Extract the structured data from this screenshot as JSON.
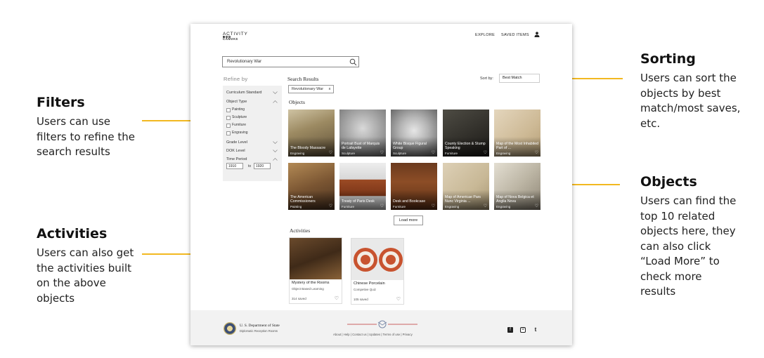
{
  "annotations": {
    "filters": {
      "title": "Filters",
      "lines": [
        "Users can use",
        "filters to refine the",
        "search results"
      ]
    },
    "activities": {
      "title": "Activities",
      "lines": [
        "Users can also get",
        "the activities built",
        "on the above",
        "objects"
      ]
    },
    "sorting": {
      "title": "Sorting",
      "lines": [
        "Users can sort the",
        "objects by best",
        "match/most saves,",
        "etc."
      ]
    },
    "objects": {
      "title": "Objects",
      "lines": [
        "Users can find the",
        "top 10 related",
        "objects here, they",
        "can also click",
        "“Load More” to",
        "check more",
        "results"
      ]
    }
  },
  "colors": {
    "accent": "#f2b820"
  },
  "header": {
    "brand_line1": "ACTIVITY",
    "brand_line2": "CANVAS",
    "nav_explore": "EXPLORE",
    "nav_saved": "SAVED ITEMS",
    "user_icon": "user-icon"
  },
  "search": {
    "value": "Revolutionary War",
    "icon": "search-icon"
  },
  "sidebar": {
    "refine_label": "Refine by",
    "curriculum": "Curriculum Standard",
    "object_type": "Object Type",
    "types": [
      "Painting",
      "Sculpture",
      "Furniture",
      "Engraving"
    ],
    "grade": "Grade Level",
    "dok": "DOK Level",
    "time_period": "Time Period",
    "year_from": "1910",
    "year_to": "1920",
    "to_label": "to"
  },
  "results": {
    "title": "Search Results",
    "tag": "Revolutionary War",
    "tag_close": "x",
    "sort_label": "Sort by:",
    "sort_value": "Best Match",
    "objects_heading": "Objects",
    "objects": [
      {
        "title": "The Bloody Massacre",
        "type": "Engraving"
      },
      {
        "title": "Portrait Bust of Marquis de Lafayette",
        "type": "Sculpture"
      },
      {
        "title": "White Bisque Figural Group",
        "type": "Sculpture"
      },
      {
        "title": "County Election & Stump Speaking",
        "type": "Furniture"
      },
      {
        "title": "Map of the Most Inhabited Part of ...",
        "type": "Engraving"
      },
      {
        "title": "The American Commissioners",
        "type": "Painting"
      },
      {
        "title": "Treaty of Paris Desk",
        "type": "Furniture"
      },
      {
        "title": "Desk and Bookcase",
        "type": "Furniture"
      },
      {
        "title": "Map of Americae Pars Nunc Virginia ...",
        "type": "Engraving"
      },
      {
        "title": "Map of Nova Belgica et Anglia Nova",
        "type": "Engraving"
      }
    ],
    "load_more": "Load more",
    "activities_heading": "Activities",
    "activities": [
      {
        "title": "Mystery of the Rooms",
        "subtitle": "Object Based Learning",
        "saved": "314 saved"
      },
      {
        "title": "Chinese Porcelain",
        "subtitle": "Competive Quiz",
        "saved": "105 saved"
      }
    ]
  },
  "footer": {
    "dept": "U. S. Department of State",
    "dept_sub": "Diplomatic Reception Rooms",
    "links": "About | Help | Contact us | Updates | Terms of use | Privacy",
    "social": [
      "f",
      "o",
      "t"
    ]
  }
}
